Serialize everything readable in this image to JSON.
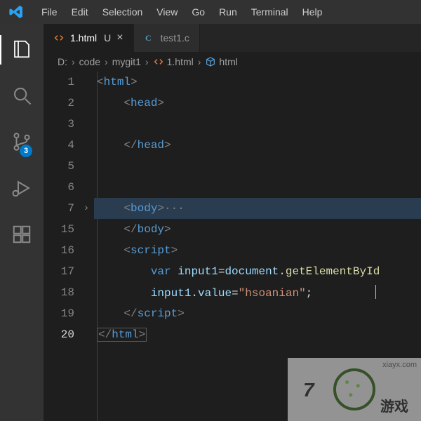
{
  "menu": {
    "items": [
      "File",
      "Edit",
      "Selection",
      "View",
      "Go",
      "Run",
      "Terminal",
      "Help"
    ]
  },
  "activity": {
    "items": [
      {
        "id": "explorer",
        "icon": "files-icon",
        "active": true
      },
      {
        "id": "search",
        "icon": "search-icon"
      },
      {
        "id": "scm",
        "icon": "branch-icon",
        "badge": "3"
      },
      {
        "id": "debug",
        "icon": "debug-icon"
      },
      {
        "id": "ext",
        "icon": "extensions-icon"
      }
    ]
  },
  "tabs": {
    "items": [
      {
        "name": "1.html",
        "lang": "html",
        "active": true,
        "modified": "U",
        "close": "×"
      },
      {
        "name": "test1.c",
        "lang": "c",
        "active": false
      }
    ]
  },
  "breadcrumbs": {
    "parts": [
      {
        "label": "D:"
      },
      {
        "label": "code"
      },
      {
        "label": "mygit1"
      },
      {
        "label": "1.html",
        "icon": "html-icon"
      },
      {
        "label": "html",
        "icon": "cube-icon"
      }
    ],
    "sep": "›"
  },
  "editor": {
    "lineNumbers": [
      "1",
      "2",
      "3",
      "4",
      "5",
      "6",
      "7",
      "15",
      "16",
      "17",
      "18",
      "19",
      "20"
    ],
    "currentLine": "20",
    "foldRow": "7",
    "foldGlyph": "›",
    "foldedDots": "···",
    "code": {
      "l1": {
        "open": "<",
        "tag": "html",
        "close": ">"
      },
      "l2": {
        "open": "<",
        "tag": "head",
        "close": ">"
      },
      "l4": {
        "open": "</",
        "tag": "head",
        "close": ">"
      },
      "l7": {
        "open": "<",
        "tag": "body",
        "close": ">"
      },
      "l15": {
        "open": "</",
        "tag": "body",
        "close": ">"
      },
      "l16": {
        "open": "<",
        "tag": "script",
        "close": ">"
      },
      "l17": {
        "kw": "var",
        "ident": "input1",
        "eq": "=",
        "obj": "document",
        "dot": ".",
        "fn": "getElementById"
      },
      "l18": {
        "ident": "input1",
        "dot": ".",
        "prop": "value",
        "eq": "=",
        "str": "\"hsoanian\"",
        "semi": ";"
      },
      "l19": {
        "open": "</",
        "tag": "script",
        "close": ">"
      },
      "l20": {
        "open": "</",
        "tag": "html",
        "close": ">"
      }
    }
  },
  "watermark": {
    "url": "xiayx.com",
    "num": "7",
    "cn": "游戏"
  }
}
